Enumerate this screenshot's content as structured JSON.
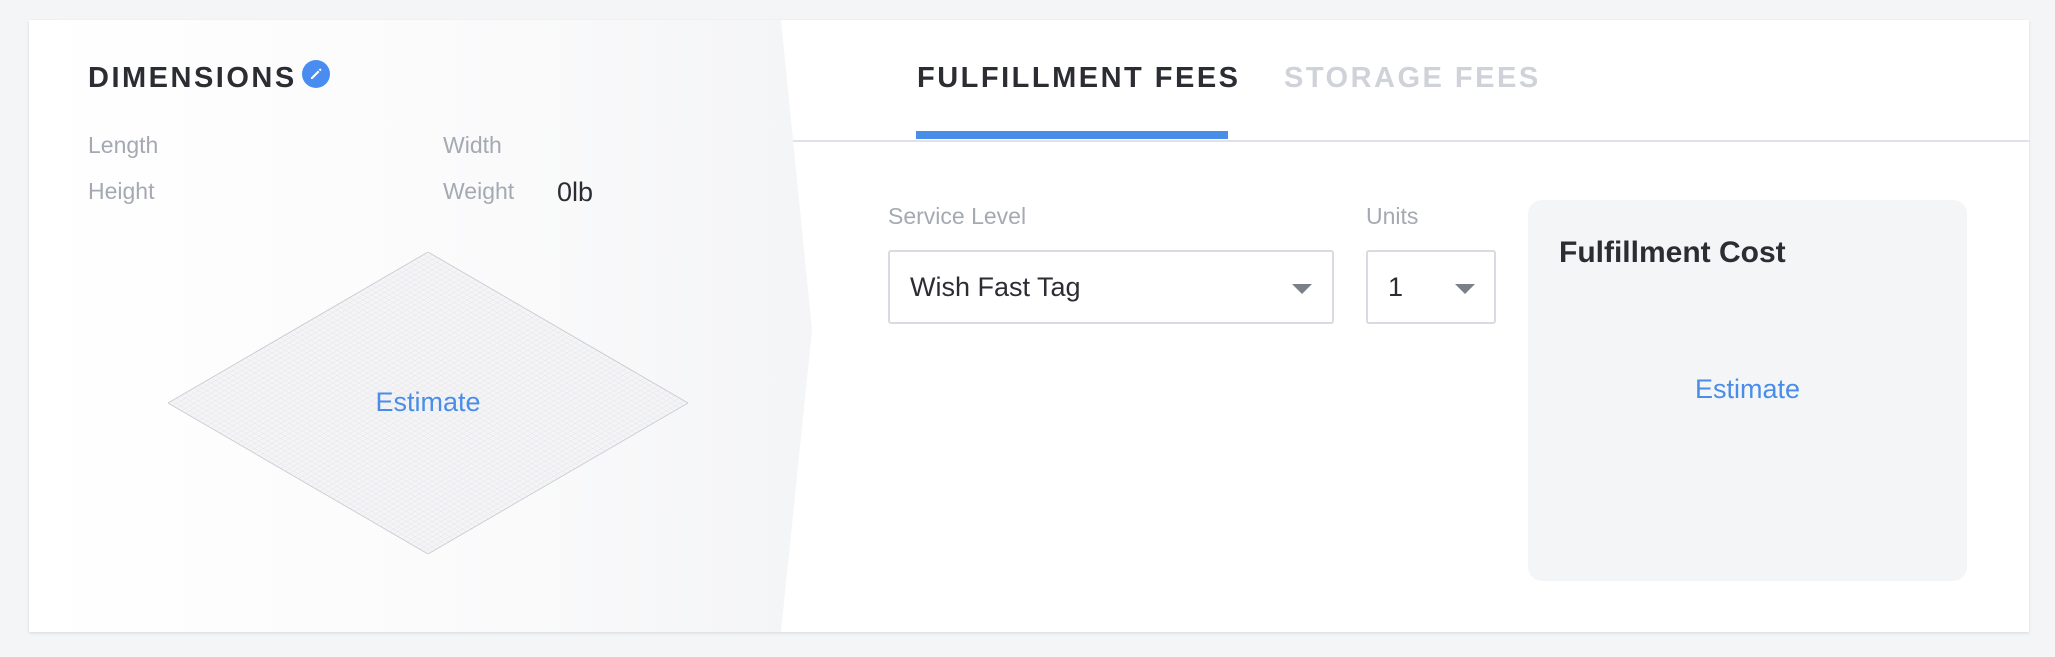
{
  "dimensions": {
    "title": "DIMENSIONS",
    "length_label": "Length",
    "width_label": "Width",
    "height_label": "Height",
    "weight_label": "Weight",
    "weight_value": "0lb",
    "estimate_label": "Estimate"
  },
  "tabs": {
    "fulfillment": "FULFILLMENT FEES",
    "storage": "STORAGE FEES",
    "active": "fulfillment"
  },
  "form": {
    "service_level_label": "Service Level",
    "service_level_value": "Wish Fast Tag",
    "units_label": "Units",
    "units_value": "1"
  },
  "cost": {
    "title": "Fulfillment Cost",
    "estimate_label": "Estimate"
  },
  "colors": {
    "accent": "#4a8de8",
    "text_dark": "#2b2d33",
    "label_gray": "#a5a9b2",
    "tab_inactive": "#cfd2d8",
    "panel_bg": "#f4f5f7"
  },
  "icons": {
    "edit": "pencil-icon",
    "dropdown": "chevron-down-icon"
  }
}
